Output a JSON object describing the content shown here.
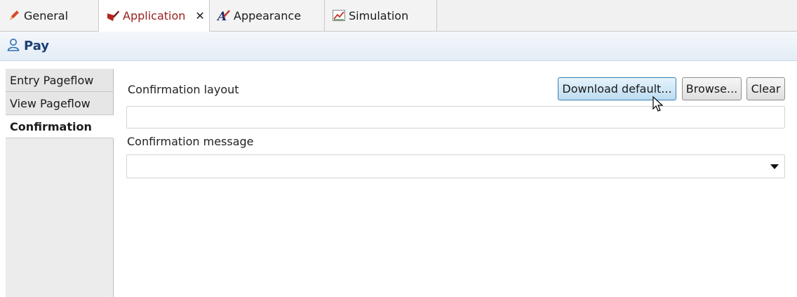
{
  "tabs": [
    {
      "label": "General",
      "icon": "pencil-icon"
    },
    {
      "label": "Application",
      "icon": "application-icon",
      "active": true,
      "close": "✕"
    },
    {
      "label": "Appearance",
      "icon": "appearance-icon"
    },
    {
      "label": "Simulation",
      "icon": "simulation-icon"
    }
  ],
  "header": {
    "title": "Pay",
    "icon": "user-icon"
  },
  "sidebar": {
    "items": [
      {
        "label": "Entry Pageflow"
      },
      {
        "label": "View Pageflow"
      },
      {
        "label": "Confirmation",
        "active": true
      }
    ]
  },
  "main": {
    "layout_label": "Confirmation layout",
    "layout_value": "",
    "message_label": "Confirmation message",
    "message_value": "",
    "buttons": {
      "download": "Download default...",
      "browse": "Browse...",
      "clear": "Clear"
    }
  },
  "colors": {
    "active_tab_text": "#9a2020",
    "header_title": "#1e3f73",
    "button_hover": "#bcdcf1"
  }
}
